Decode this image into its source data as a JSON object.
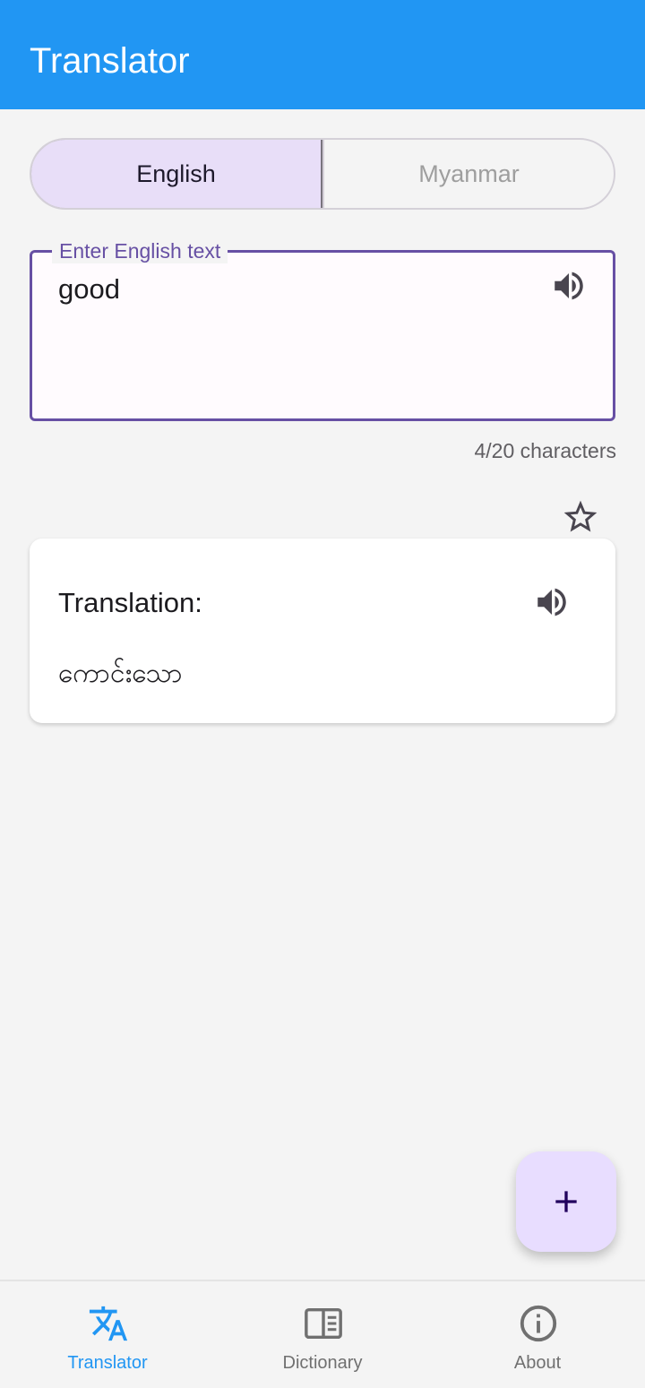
{
  "app_bar": {
    "title": "Translator"
  },
  "language_toggle": {
    "options": [
      "English",
      "Myanmar"
    ],
    "selected": "English"
  },
  "input": {
    "label": "Enter English text",
    "value": "good",
    "counter": "4/20 characters"
  },
  "result": {
    "title": "Translation:",
    "text": "ကောင်းသော"
  },
  "icons": {
    "speaker": "volume-up-icon",
    "favorite": "star-outline-icon",
    "fab": "add-icon",
    "translator": "translate-icon",
    "dictionary": "dictionary-icon",
    "about": "info-icon"
  },
  "bottom_nav": {
    "items": [
      {
        "label": "Translator",
        "active": true
      },
      {
        "label": "Dictionary",
        "active": false
      },
      {
        "label": "About",
        "active": false
      }
    ]
  },
  "colors": {
    "app_bar": "#2196f3",
    "accent": "#6750a4",
    "selected_segment": "#e8def8",
    "fab": "#e8ddff",
    "nav_active": "#2196f3"
  }
}
